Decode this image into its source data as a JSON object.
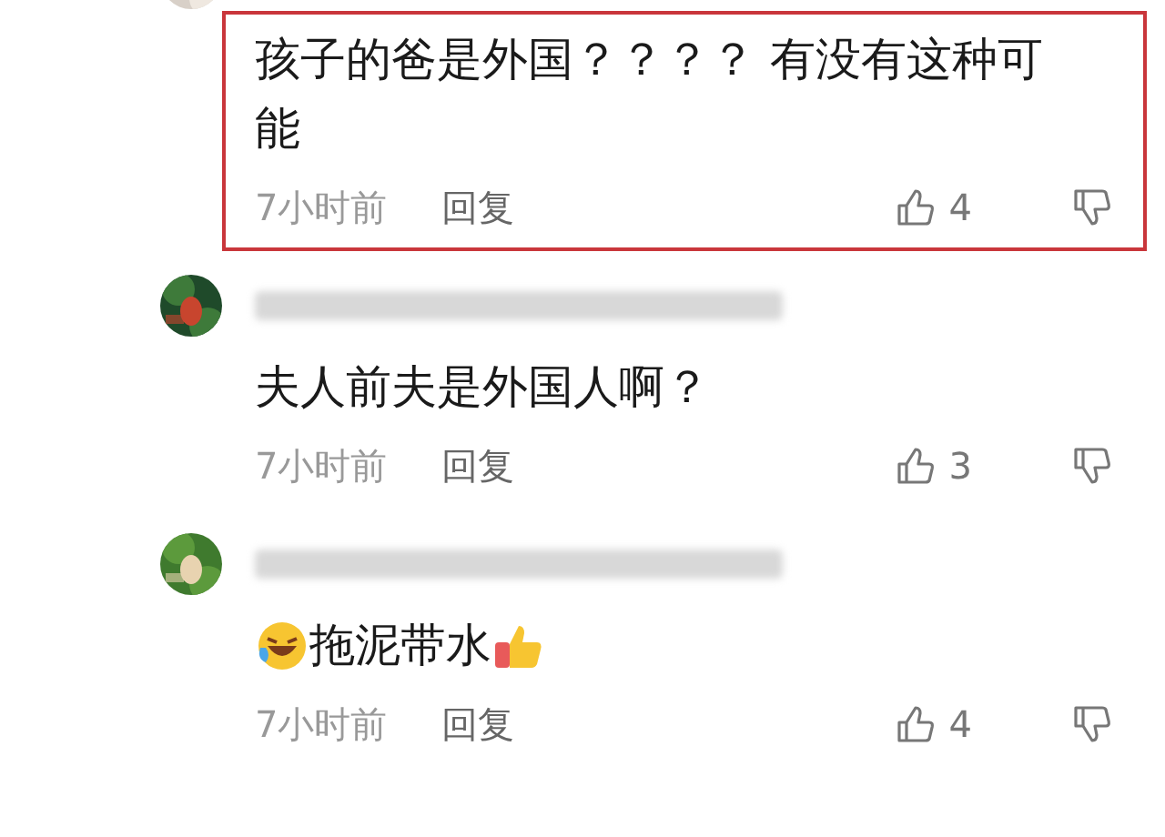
{
  "comments": [
    {
      "redacted_name": false,
      "highlighted": true,
      "content": [
        {
          "kind": "text",
          "text": "孩子的爸是外国？？？？ 有没有这种可能"
        }
      ],
      "time": "7小时前",
      "reply": "回复",
      "likes": "4"
    },
    {
      "redacted_name": true,
      "highlighted": false,
      "content": [
        {
          "kind": "text",
          "text": "夫人前夫是外国人啊？"
        }
      ],
      "time": "7小时前",
      "reply": "回复",
      "likes": "3"
    },
    {
      "redacted_name": true,
      "highlighted": false,
      "content": [
        {
          "kind": "laugh_emoji"
        },
        {
          "kind": "text",
          "text": "拖泥带水"
        },
        {
          "kind": "thumb_emoji"
        }
      ],
      "time": "7小时前",
      "reply": "回复",
      "likes": "4"
    }
  ]
}
